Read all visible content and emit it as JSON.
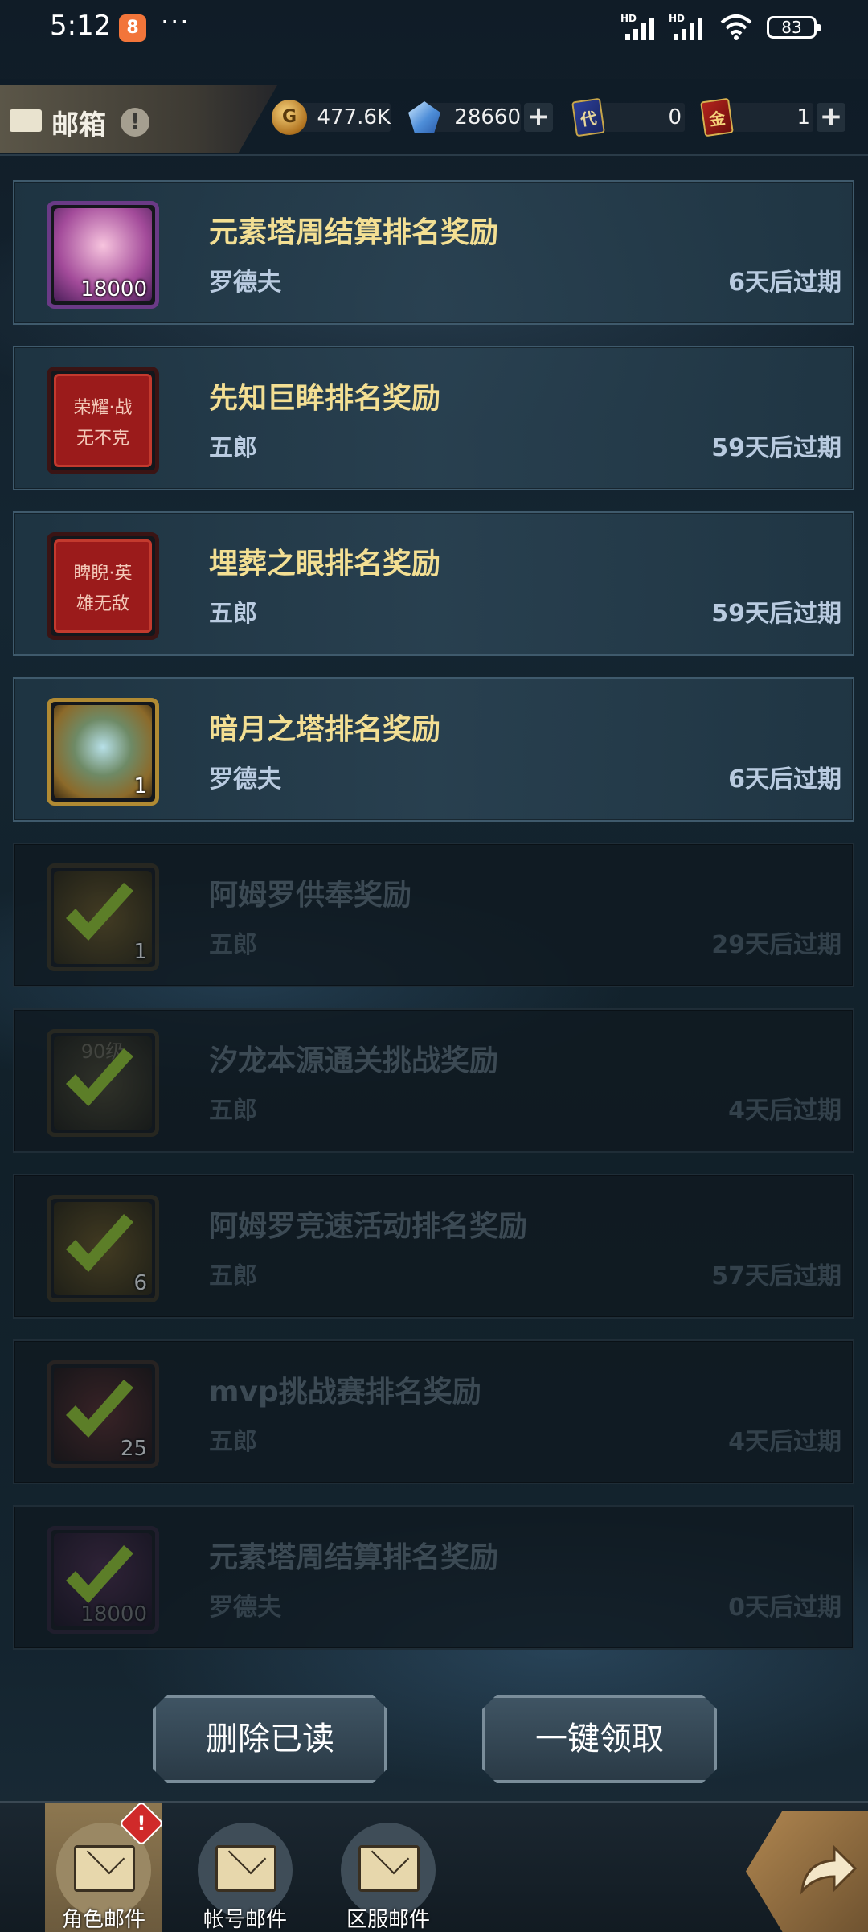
{
  "status_bar": {
    "time": "5:12",
    "app_badge": "8",
    "more": "···",
    "signal1_label": "HD",
    "signal2_label": "HD",
    "battery": "83"
  },
  "header": {
    "title": "邮箱",
    "info_icon": "!",
    "gold": "477.6K",
    "crystal": "28660",
    "card_blue": "0",
    "card_red": "1",
    "plus": "+"
  },
  "mails": [
    {
      "title": "元素塔周结算排名奖励",
      "sender": "罗德夫",
      "expire": "6天后过期",
      "count": "18000",
      "thumb": "pink-crystal",
      "read": false
    },
    {
      "title": "先知巨眸排名奖励",
      "sender": "五郎",
      "expire": "59天后过期",
      "thumb_text": "荣耀·战\n无不克",
      "thumb": "red-title-card",
      "read": false
    },
    {
      "title": "埋葬之眼排名奖励",
      "sender": "五郎",
      "expire": "59天后过期",
      "thumb_text": "睥睨·英\n雄无敌",
      "thumb": "red-title-card",
      "read": false
    },
    {
      "title": "暗月之塔排名奖励",
      "sender": "罗德夫",
      "expire": "6天后过期",
      "count": "1",
      "thumb": "gold-chest",
      "read": false
    },
    {
      "title": "阿姆罗供奉奖励",
      "sender": "五郎",
      "expire": "29天后过期",
      "count": "1",
      "thumb": "gold-coins",
      "read": true
    },
    {
      "title": "汐龙本源通关挑战奖励",
      "sender": "五郎",
      "expire": "4天后过期",
      "thumb_text": "90级",
      "thumb": "level-badge",
      "read": true
    },
    {
      "title": "阿姆罗竞速活动排名奖励",
      "sender": "五郎",
      "expire": "57天后过期",
      "count": "6",
      "thumb": "gold-coins",
      "read": true
    },
    {
      "title": "mvp挑战赛排名奖励",
      "sender": "五郎",
      "expire": "4天后过期",
      "count": "25",
      "thumb": "red-jar",
      "read": true
    },
    {
      "title": "元素塔周结算排名奖励",
      "sender": "罗德夫",
      "expire": "0天后过期",
      "count": "18000",
      "thumb": "pink-crystal",
      "read": true
    }
  ],
  "buttons": {
    "delete_read": "删除已读",
    "claim_all": "一键领取"
  },
  "bottom_tabs": [
    {
      "label": "角色邮件",
      "active": true
    },
    {
      "label": "帐号邮件",
      "active": false
    },
    {
      "label": "区服邮件",
      "active": false
    }
  ],
  "badge": "!"
}
